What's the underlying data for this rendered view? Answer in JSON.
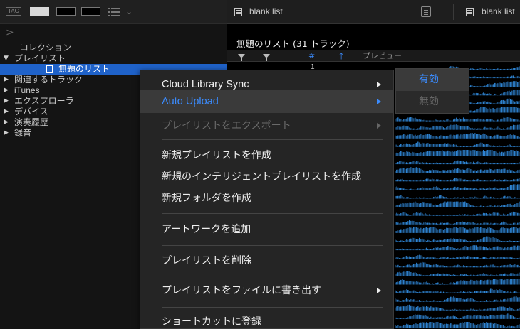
{
  "tag_bar": {
    "tag_label": "TAG",
    "swatch_colors": [
      "#d9d9d9",
      "#000000",
      "#000000"
    ]
  },
  "sidebar": {
    "collapse_glyph": ">",
    "items": [
      {
        "label": "コレクション",
        "expander": "",
        "selected": false
      },
      {
        "label": "プレイリスト",
        "expander": "▼",
        "selected": false
      },
      {
        "label": "無題のリスト",
        "expander": "",
        "selected": true
      },
      {
        "label": "関連するトラック",
        "expander": "▶",
        "selected": false
      },
      {
        "label": "iTunes",
        "expander": "▶",
        "selected": false
      },
      {
        "label": "エクスプローラ",
        "expander": "▶",
        "selected": false
      },
      {
        "label": "デバイス",
        "expander": "▶",
        "selected": false
      },
      {
        "label": "演奏履歴",
        "expander": "▶",
        "selected": false
      },
      {
        "label": "録音",
        "expander": "▶",
        "selected": false
      }
    ]
  },
  "tabs": [
    {
      "label": "blank list"
    },
    {
      "label": "blank list"
    }
  ],
  "list": {
    "title": "無題のリスト (31 トラック)",
    "columns": {
      "number": "#",
      "sort_glyph": "🡑",
      "preview": "プレビュー"
    },
    "first_row_number": "1"
  },
  "context_menu": {
    "items": [
      {
        "label": "Cloud Library Sync",
        "submenu": true,
        "state": "normal"
      },
      {
        "label": "Auto Upload",
        "submenu": true,
        "state": "active"
      },
      {
        "label": "プレイリストをエクスポート",
        "submenu": true,
        "state": "disabled"
      },
      {
        "label": "新規プレイリストを作成",
        "submenu": false,
        "state": "normal"
      },
      {
        "label": "新規のインテリジェントプレイリストを作成",
        "submenu": false,
        "state": "normal"
      },
      {
        "label": "新規フォルダを作成",
        "submenu": false,
        "state": "normal"
      },
      {
        "label": "アートワークを追加",
        "submenu": false,
        "state": "normal"
      },
      {
        "label": "プレイリストを削除",
        "submenu": false,
        "state": "normal"
      },
      {
        "label": "プレイリストをファイルに書き出す",
        "submenu": true,
        "state": "normal"
      },
      {
        "label": "ショートカットに登録",
        "submenu": false,
        "state": "normal"
      }
    ]
  },
  "submenu": {
    "enable_label": "有効",
    "disable_label": "無効"
  },
  "colors": {
    "accent": "#3b8cff",
    "selection": "#1f62c9",
    "waveform": "#2f86d6"
  }
}
